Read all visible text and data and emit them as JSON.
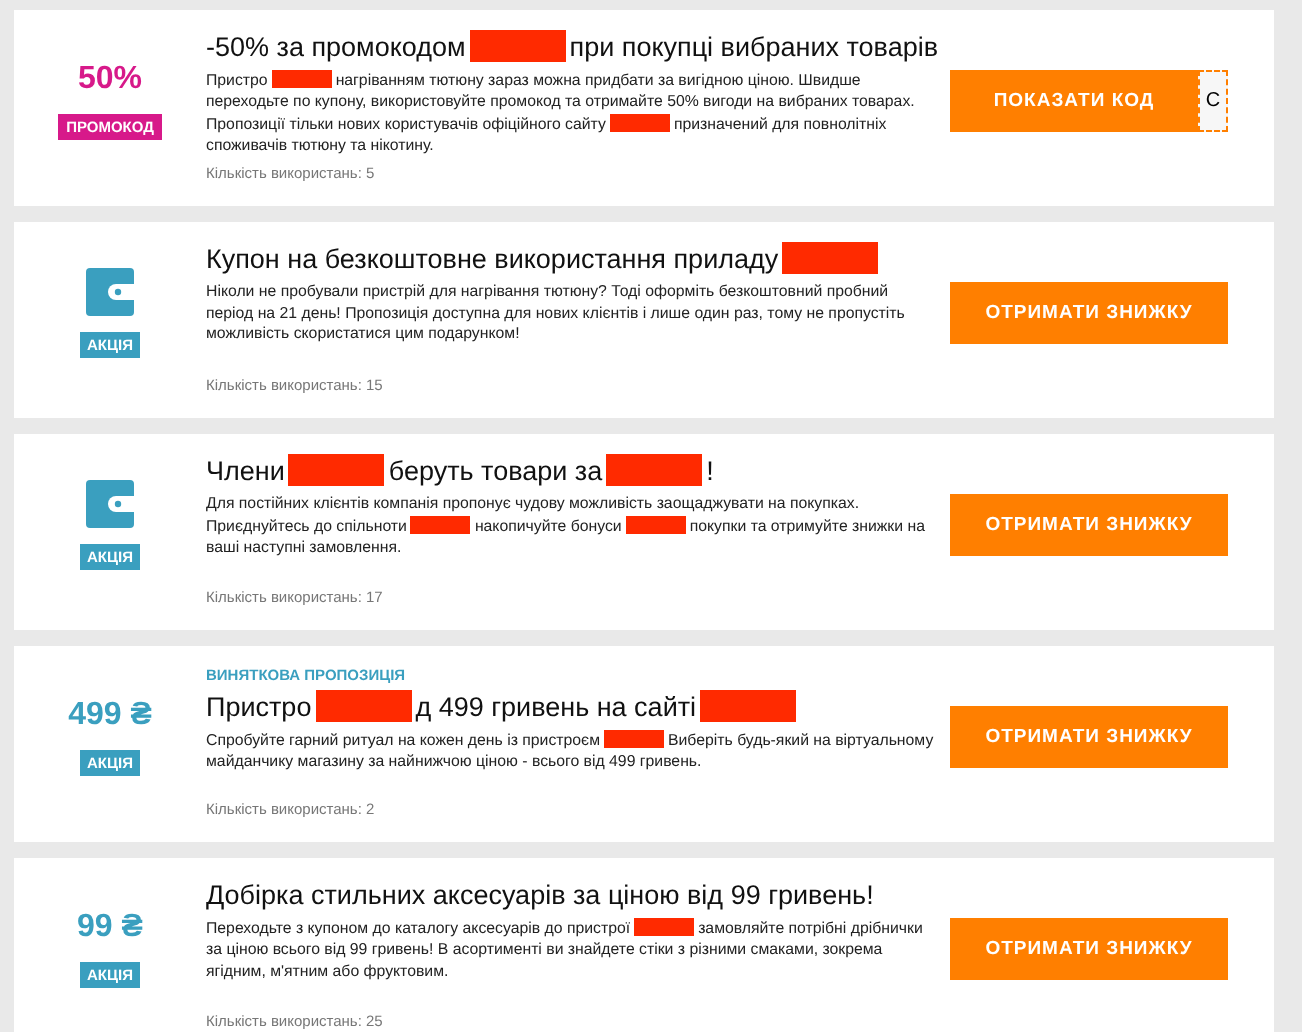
{
  "cards": [
    {
      "kind": "promo",
      "value": "50%",
      "badge": "ПРОМОКОД",
      "title": [
        {
          "kind": "text",
          "text": "-50% за промокодом"
        },
        {
          "kind": "redacted"
        },
        {
          "kind": "text",
          "text": "при покупці вибраних товарів"
        }
      ],
      "description": [
        {
          "kind": "text",
          "text": "Пристро"
        },
        {
          "kind": "redacted"
        },
        {
          "kind": "text",
          "text": "нагріванням тютюну зараз можна придбати за вигідною ціною. Швидше переходьте по купону, використовуйте промокод та отримайте 50% вигоди на вибраних товарах. Пропозиції тільки нових користувачів офіційного сайту"
        },
        {
          "kind": "redacted"
        },
        {
          "kind": "text",
          "text": "призначений для повнолітніх споживачів тютюну та нікотину."
        }
      ],
      "uses": "Кількість використань: 5",
      "button": {
        "label": "ПОКАЗАТИ КОД",
        "code_peek": "С"
      }
    },
    {
      "kind": "deal",
      "badge": "АКЦІЯ",
      "title": [
        {
          "kind": "text",
          "text": "Купон на безкоштовне використання приладу"
        },
        {
          "kind": "redacted"
        }
      ],
      "description": [
        {
          "kind": "text",
          "text": "Ніколи не пробували пристрій для нагрівання тютюну? Тоді оформіть безкоштовний пробний період на 21 день! Пропозиція доступна для нових клієнтів і лише один раз, тому не пропустіть можливість скористатися цим подарунком!"
        }
      ],
      "uses": "Кількість використань: 15",
      "button": {
        "label": "ОТРИМАТИ ЗНИЖКУ"
      }
    },
    {
      "kind": "deal",
      "badge": "АКЦІЯ",
      "title": [
        {
          "kind": "text",
          "text": "Члени"
        },
        {
          "kind": "redacted"
        },
        {
          "kind": "text",
          "text": "беруть товари за"
        },
        {
          "kind": "redacted"
        },
        {
          "kind": "text",
          "text": "!"
        }
      ],
      "description": [
        {
          "kind": "text",
          "text": "Для постійних клієнтів компанія пропонує чудову можливість заощаджувати на покупках. Приєднуйтесь до спільноти"
        },
        {
          "kind": "redacted"
        },
        {
          "kind": "text",
          "text": "накопичуйте бонуси"
        },
        {
          "kind": "redacted"
        },
        {
          "kind": "text",
          "text": "покупки та отримуйте знижки на ваші наступні замовлення."
        }
      ],
      "uses": "Кількість використань: 17",
      "button": {
        "label": "ОТРИМАТИ ЗНИЖКУ"
      }
    },
    {
      "kind": "deal",
      "value": "499 ₴",
      "badge": "АКЦІЯ",
      "tagline": "ВИНЯТКОВА ПРОПОЗИЦІЯ",
      "title": [
        {
          "kind": "text",
          "text": "Пристро"
        },
        {
          "kind": "redacted"
        },
        {
          "kind": "text",
          "text": "д 499 гривень на сайті"
        },
        {
          "kind": "redacted"
        }
      ],
      "description": [
        {
          "kind": "text",
          "text": "Спробуйте гарний ритуал на кожен день із пристроєм"
        },
        {
          "kind": "redacted"
        },
        {
          "kind": "text",
          "text": "Виберіть будь-який на віртуальному майданчику магазину за найнижчою ціною - всього від 499 гривень."
        }
      ],
      "uses": "Кількість використань: 2",
      "button": {
        "label": "ОТРИМАТИ ЗНИЖКУ"
      }
    },
    {
      "kind": "deal",
      "value": "99 ₴",
      "badge": "АКЦІЯ",
      "title": [
        {
          "kind": "text",
          "text": "Добірка стильних аксесуарів за ціною від 99 гривень!"
        }
      ],
      "description": [
        {
          "kind": "text",
          "text": "Переходьте з купоном до каталогу аксесуарів до пристрої"
        },
        {
          "kind": "redacted"
        },
        {
          "kind": "text",
          "text": "замовляйте потрібні дрібнички за ціною всього від 99 гривень! В асортименті ви знайдете стіки з різними смаками, зокрема ягідним, м'ятним або фруктовим."
        }
      ],
      "uses": "Кількість використань: 25",
      "button": {
        "label": "ОТРИМАТИ ЗНИЖКУ"
      }
    }
  ]
}
